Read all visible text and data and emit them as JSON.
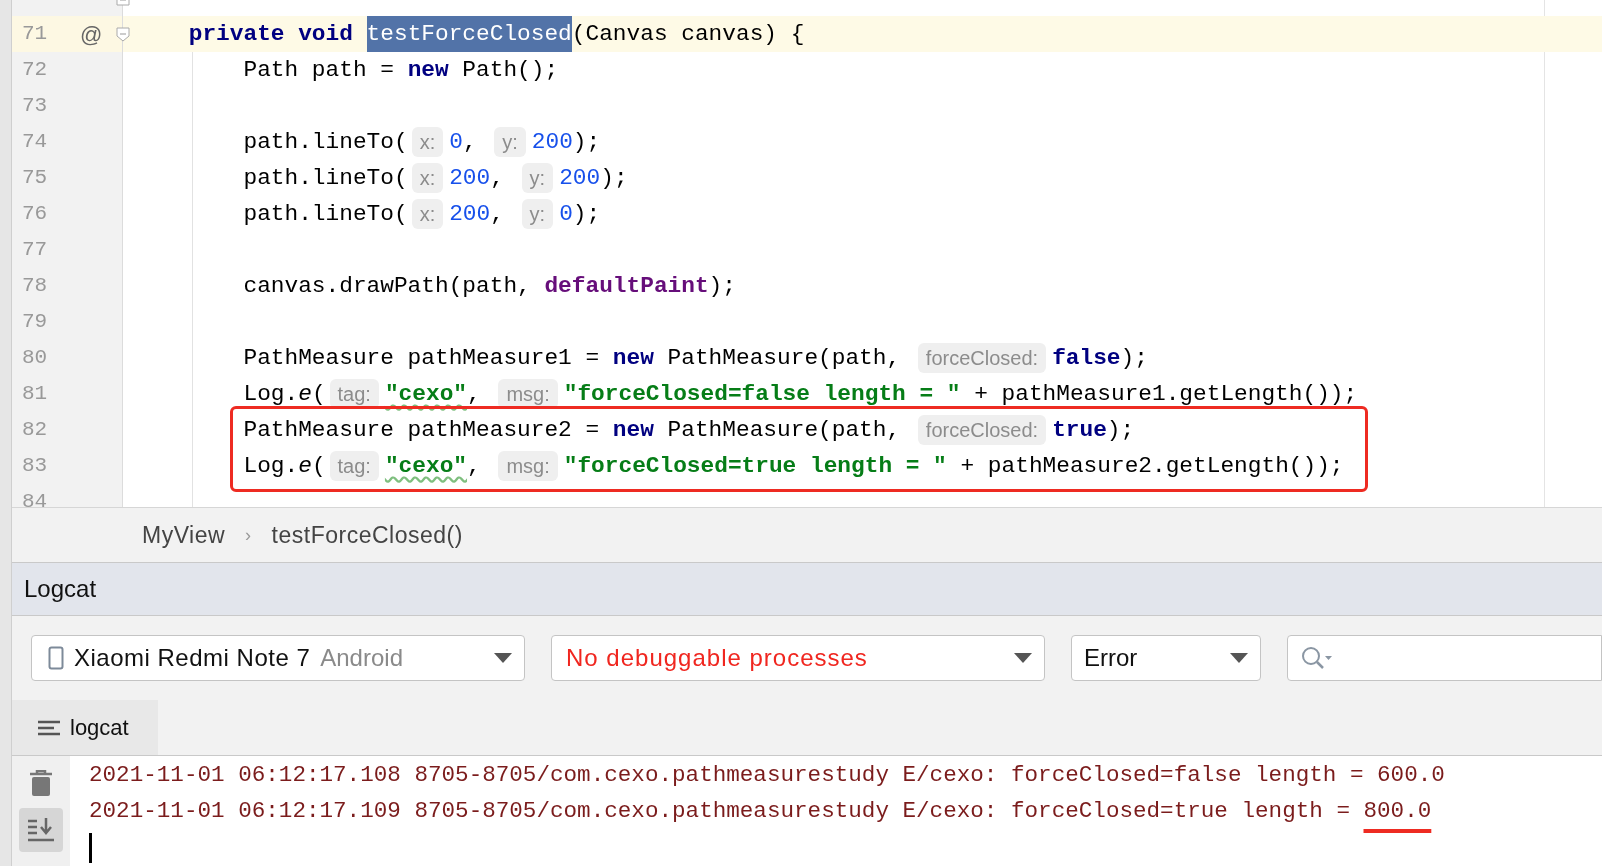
{
  "editor": {
    "lines": [
      {
        "current": false,
        "fold_end": true
      },
      {
        "number": "71",
        "current": true,
        "gutter_icon": "@",
        "fold_start": true,
        "segments": [
          {
            "kind": "keyword",
            "text": "    private void "
          },
          {
            "kind": "selection",
            "text": "testForceClosed"
          },
          {
            "kind": "plain",
            "text": "(Canvas canvas) {"
          }
        ]
      },
      {
        "number": "72",
        "current": false,
        "segments": [
          {
            "kind": "plain",
            "text": "        Path path = "
          },
          {
            "kind": "keyword",
            "text": "new"
          },
          {
            "kind": "plain",
            "text": " Path();"
          }
        ]
      },
      {
        "number": "73",
        "current": false
      },
      {
        "number": "74",
        "current": false,
        "segments": [
          {
            "kind": "plain",
            "text": "        path.lineTo("
          },
          {
            "kind": "hint",
            "text": "x:"
          },
          {
            "kind": "number",
            "text": "0"
          },
          {
            "kind": "plain",
            "text": ", "
          },
          {
            "kind": "hint",
            "text": "y:"
          },
          {
            "kind": "number",
            "text": "200"
          },
          {
            "kind": "plain",
            "text": ");"
          }
        ]
      },
      {
        "number": "75",
        "current": false,
        "segments": [
          {
            "kind": "plain",
            "text": "        path.lineTo("
          },
          {
            "kind": "hint",
            "text": "x:"
          },
          {
            "kind": "number",
            "text": "200"
          },
          {
            "kind": "plain",
            "text": ", "
          },
          {
            "kind": "hint",
            "text": "y:"
          },
          {
            "kind": "number",
            "text": "200"
          },
          {
            "kind": "plain",
            "text": ");"
          }
        ]
      },
      {
        "number": "76",
        "current": false,
        "segments": [
          {
            "kind": "plain",
            "text": "        path.lineTo("
          },
          {
            "kind": "hint",
            "text": "x:"
          },
          {
            "kind": "number",
            "text": "200"
          },
          {
            "kind": "plain",
            "text": ", "
          },
          {
            "kind": "hint",
            "text": "y:"
          },
          {
            "kind": "number",
            "text": "0"
          },
          {
            "kind": "plain",
            "text": ");"
          }
        ]
      },
      {
        "number": "77",
        "current": false
      },
      {
        "number": "78",
        "current": false,
        "segments": [
          {
            "kind": "plain",
            "text": "        canvas.drawPath(path, "
          },
          {
            "kind": "field",
            "text": "defaultPaint"
          },
          {
            "kind": "plain",
            "text": ");"
          }
        ]
      },
      {
        "number": "79",
        "current": false
      },
      {
        "number": "80",
        "current": false,
        "segments": [
          {
            "kind": "plain",
            "text": "        PathMeasure pathMeasure1 = "
          },
          {
            "kind": "keyword",
            "text": "new"
          },
          {
            "kind": "plain",
            "text": " PathMeasure(path, "
          },
          {
            "kind": "hint",
            "text": "forceClosed:"
          },
          {
            "kind": "keyword",
            "text": "false"
          },
          {
            "kind": "plain",
            "text": ");"
          }
        ]
      },
      {
        "number": "81",
        "current": false,
        "segments": [
          {
            "kind": "plain",
            "text": "        Log."
          },
          {
            "kind": "italic",
            "text": "e"
          },
          {
            "kind": "plain",
            "text": "("
          },
          {
            "kind": "hint",
            "text": "tag:"
          },
          {
            "kind": "string",
            "text": "\"cexo\"",
            "typo": true
          },
          {
            "kind": "plain",
            "text": ", "
          },
          {
            "kind": "hint",
            "text": "msg:"
          },
          {
            "kind": "string",
            "text": "\"forceClosed=false length = \""
          },
          {
            "kind": "plain",
            "text": " + pathMeasure1.getLength());"
          }
        ]
      },
      {
        "number": "82",
        "current": false,
        "boxed": true,
        "segments": [
          {
            "kind": "plain",
            "text": "        PathMeasure pathMeasure2 = "
          },
          {
            "kind": "keyword",
            "text": "new"
          },
          {
            "kind": "plain",
            "text": " PathMeasure(path, "
          },
          {
            "kind": "hint",
            "text": "forceClosed:"
          },
          {
            "kind": "keyword",
            "text": "true"
          },
          {
            "kind": "plain",
            "text": ");"
          }
        ]
      },
      {
        "number": "83",
        "current": false,
        "boxed": true,
        "segments": [
          {
            "kind": "plain",
            "text": "        Log."
          },
          {
            "kind": "italic",
            "text": "e"
          },
          {
            "kind": "plain",
            "text": "("
          },
          {
            "kind": "hint",
            "text": "tag:"
          },
          {
            "kind": "string",
            "text": "\"cexo\"",
            "typo": true
          },
          {
            "kind": "plain",
            "text": ", "
          },
          {
            "kind": "hint",
            "text": "msg:"
          },
          {
            "kind": "string",
            "text": "\"forceClosed=true length = \""
          },
          {
            "kind": "plain",
            "text": " + pathMeasure2.getLength());"
          }
        ]
      },
      {
        "number": "84",
        "current": false
      }
    ]
  },
  "breadcrumb": {
    "items": [
      "MyView",
      "testForceClosed()"
    ],
    "separator": "›"
  },
  "logcat": {
    "title": "Logcat",
    "device": {
      "name": "Xiaomi Redmi Note 7",
      "detail": "Android"
    },
    "process": {
      "text": "No debuggable processes",
      "error": true
    },
    "level": "Error",
    "tab": "logcat",
    "lines": [
      {
        "segments": [
          {
            "text": "2021-11-01 06:12:17.108 8705-8705/com.cexo.pathmeasurestudy E/cexo: forceClosed=false length = 600.0"
          }
        ]
      },
      {
        "segments": [
          {
            "text": "2021-11-01 06:12:17.109 8705-8705/com.cexo.pathmeasurestudy E/cexo: forceClosed=true length = "
          },
          {
            "text": "800.0",
            "underlined": true
          }
        ]
      }
    ]
  }
}
